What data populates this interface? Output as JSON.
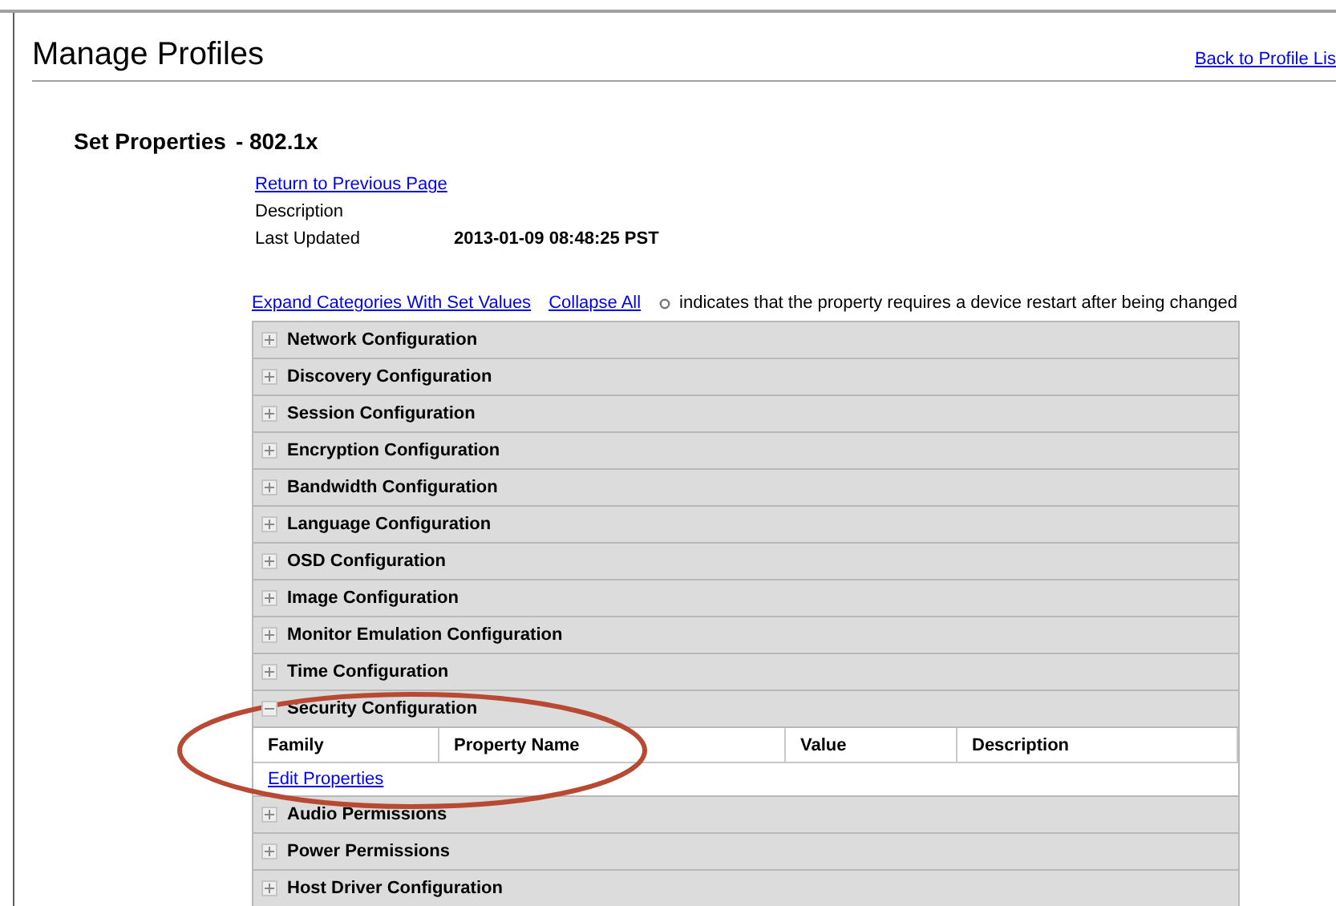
{
  "page": {
    "title": "Manage Profiles",
    "back_link": "Back to Profile Lis"
  },
  "section": {
    "title": "Set Properties",
    "subtitle": "- 802.1x"
  },
  "info": {
    "return_link": "Return to Previous Page",
    "rows": [
      {
        "label": "Description",
        "value": ""
      },
      {
        "label": "Last Updated",
        "value": "2013-01-09 08:48:25 PST"
      }
    ]
  },
  "toolbar": {
    "expand_link": "Expand Categories With Set Values",
    "collapse_link": "Collapse All",
    "legend": "indicates that the property requires a device restart after being changed"
  },
  "categories": [
    {
      "label": "Network Configuration",
      "expanded": false
    },
    {
      "label": "Discovery Configuration",
      "expanded": false
    },
    {
      "label": "Session Configuration",
      "expanded": false
    },
    {
      "label": "Encryption Configuration",
      "expanded": false
    },
    {
      "label": "Bandwidth Configuration",
      "expanded": false
    },
    {
      "label": "Language Configuration",
      "expanded": false
    },
    {
      "label": "OSD Configuration",
      "expanded": false
    },
    {
      "label": "Image Configuration",
      "expanded": false
    },
    {
      "label": "Monitor Emulation Configuration",
      "expanded": false
    },
    {
      "label": "Time Configuration",
      "expanded": false
    },
    {
      "label": "Security Configuration",
      "expanded": true,
      "columns": [
        "Family",
        "Property Name",
        "Value",
        "Description"
      ],
      "edit_link": "Edit Properties"
    },
    {
      "label": "Audio Permissions",
      "expanded": false
    },
    {
      "label": "Power Permissions",
      "expanded": false
    },
    {
      "label": "Host Driver Configuration",
      "expanded": false
    }
  ]
}
